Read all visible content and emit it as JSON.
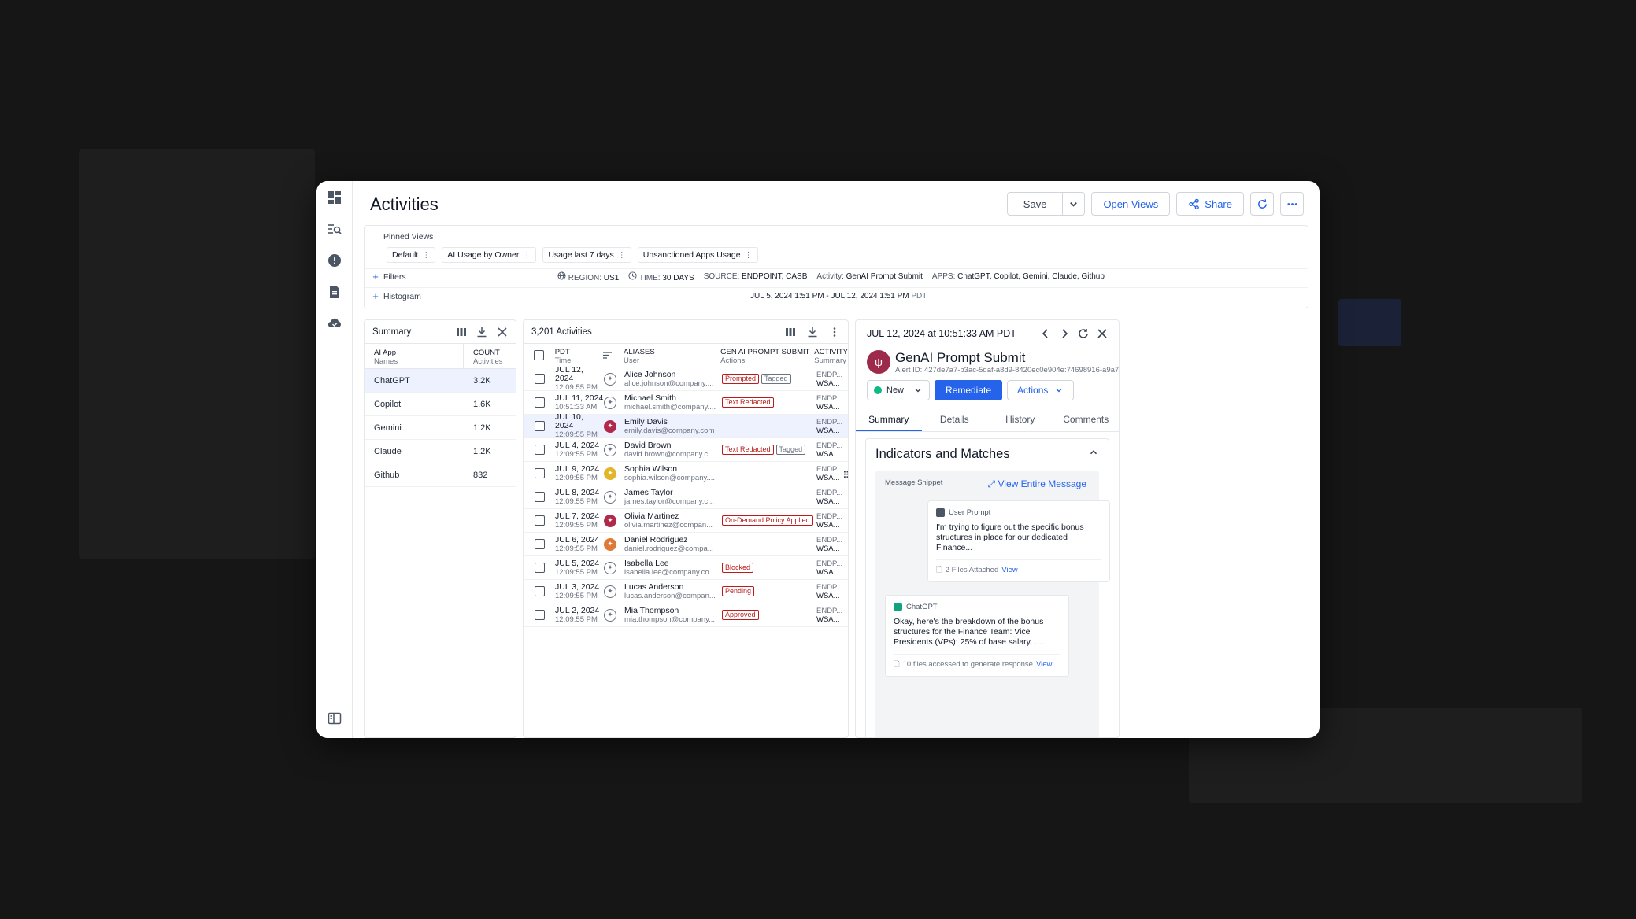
{
  "page": {
    "title": "Activities"
  },
  "toolbar": {
    "save": "Save",
    "open_views": "Open Views",
    "share": "Share"
  },
  "views": {
    "pinned_label": "Pinned Views",
    "chips": [
      "Default",
      "AI Usage by Owner",
      "Usage last 7 days",
      "Unsanctioned Apps Usage"
    ],
    "filters_label": "Filters",
    "filters": {
      "region_k": "REGION:",
      "region_v": "US1",
      "time_k": "TIME:",
      "time_v": "30 DAYS",
      "source_k": "SOURCE:",
      "source_v": "ENDPOINT, CASB",
      "activity_k": "Activity:",
      "activity_v": "GenAI Prompt Submit",
      "apps_k": "APPS:",
      "apps_v": "ChatGPT, Copilot, Gemini, Claude, Github"
    },
    "histogram_label": "Histogram",
    "histogram_range": "JUL 5, 2024 1:51 PM - JUL 12, 2024 1:51 PM",
    "histogram_tz": "PDT"
  },
  "summary": {
    "title": "Summary",
    "col1": "AI App",
    "col1_sub": "Names",
    "col2": "COUNT",
    "col2_sub": "Activities",
    "rows": [
      {
        "name": "ChatGPT",
        "count": "3.2K"
      },
      {
        "name": "Copilot",
        "count": "1.6K"
      },
      {
        "name": "Gemini",
        "count": "1.2K"
      },
      {
        "name": "Claude",
        "count": "1.2K"
      },
      {
        "name": "Github",
        "count": "832"
      }
    ]
  },
  "activities": {
    "count_label": "3,201 Activities",
    "col_time": "PDT",
    "col_time_sub": "Time",
    "col_alias": "ALIASES",
    "col_alias_sub": "User",
    "col_act": "GEN AI PROMPT SUBMIT",
    "col_act_sub": "Actions",
    "col_sum": "ACTIVITY",
    "col_sum_sub": "Summary",
    "rows": [
      {
        "date": "JUL 12, 2024",
        "time": "12:09:55 PM",
        "name": "Alice Johnson",
        "email": "alice.johnson@company....",
        "tags": [
          "Prompted",
          "Tagged"
        ],
        "s1": "ENDP...",
        "s2": "WSA..."
      },
      {
        "date": "JUL 11, 2024",
        "time": "10:51:33 AM",
        "name": "Michael Smith",
        "email": "michael.smith@company....",
        "tags": [
          "Text Redacted"
        ],
        "s1": "ENDP...",
        "s2": "WSA..."
      },
      {
        "date": "JUL 10, 2024",
        "time": "12:09:55 PM",
        "name": "Emily Davis",
        "email": "emily.davis@company.com",
        "tags": [],
        "s1": "ENDP...",
        "s2": "WSA..."
      },
      {
        "date": "JUL 4, 2024",
        "time": "12:09:55 PM",
        "name": "David Brown",
        "email": "david.brown@company.c...",
        "tags": [
          "Text Redacted",
          "Tagged"
        ],
        "s1": "ENDP...",
        "s2": "WSA..."
      },
      {
        "date": "JUL 9, 2024",
        "time": "12:09:55 PM",
        "name": "Sophia Wilson",
        "email": "sophia.wilson@company....",
        "tags": [],
        "s1": "ENDP...",
        "s2": "WSA..."
      },
      {
        "date": "JUL 8, 2024",
        "time": "12:09:55 PM",
        "name": "James Taylor",
        "email": "james.taylor@company.c...",
        "tags": [],
        "s1": "ENDP...",
        "s2": "WSA..."
      },
      {
        "date": "JUL 7, 2024",
        "time": "12:09:55 PM",
        "name": "Olivia Martinez",
        "email": "olivia.martinez@compan...",
        "tags": [
          "On-Demand Policy Applied"
        ],
        "s1": "ENDP...",
        "s2": "WSA..."
      },
      {
        "date": "JUL 6, 2024",
        "time": "12:09:55 PM",
        "name": "Daniel Rodriguez",
        "email": "daniel.rodriguez@compa...",
        "tags": [],
        "s1": "ENDP...",
        "s2": "WSA..."
      },
      {
        "date": "JUL 5, 2024",
        "time": "12:09:55 PM",
        "name": "Isabella Lee",
        "email": "isabella.lee@company.co...",
        "tags": [
          "Blocked"
        ],
        "s1": "ENDP...",
        "s2": "WSA..."
      },
      {
        "date": "JUL 3, 2024",
        "time": "12:09:55 PM",
        "name": "Lucas Anderson",
        "email": "lucas.anderson@compan...",
        "tags": [
          "Pending"
        ],
        "s1": "ENDP...",
        "s2": "WSA..."
      },
      {
        "date": "JUL 2, 2024",
        "time": "12:09:55 PM",
        "name": "Mia Thompson",
        "email": "mia.thompson@company....",
        "tags": [
          "Approved"
        ],
        "s1": "ENDP...",
        "s2": "WSA..."
      }
    ]
  },
  "detail": {
    "timestamp": "JUL 12, 2024 at 10:51:33 AM PDT",
    "title": "GenAI Prompt Submit",
    "alert_id": "Alert ID: 427de7a7-b3ac-5daf-a8d9-8420ec0e904e:74698916-a9a7...",
    "status": "New",
    "remediate": "Remediate",
    "actions": "Actions",
    "tabs": [
      "Summary",
      "Details",
      "History",
      "Comments"
    ],
    "indicators_title": "Indicators and Matches",
    "snippet_label": "Message Snippet",
    "view_entire": "View Entire Message",
    "user_prompt_label": "User Prompt",
    "user_prompt_text": "I'm trying to figure out the specific bonus structures in place for our dedicated Finance...",
    "user_files": "2 Files Attached",
    "view": "View",
    "gpt_label": "ChatGPT",
    "gpt_text": "Okay, here's the breakdown of the bonus structures for the Finance Team: Vice Presidents (VPs): 25% of base salary, ....",
    "gpt_files": "10 files accessed to generate response"
  }
}
